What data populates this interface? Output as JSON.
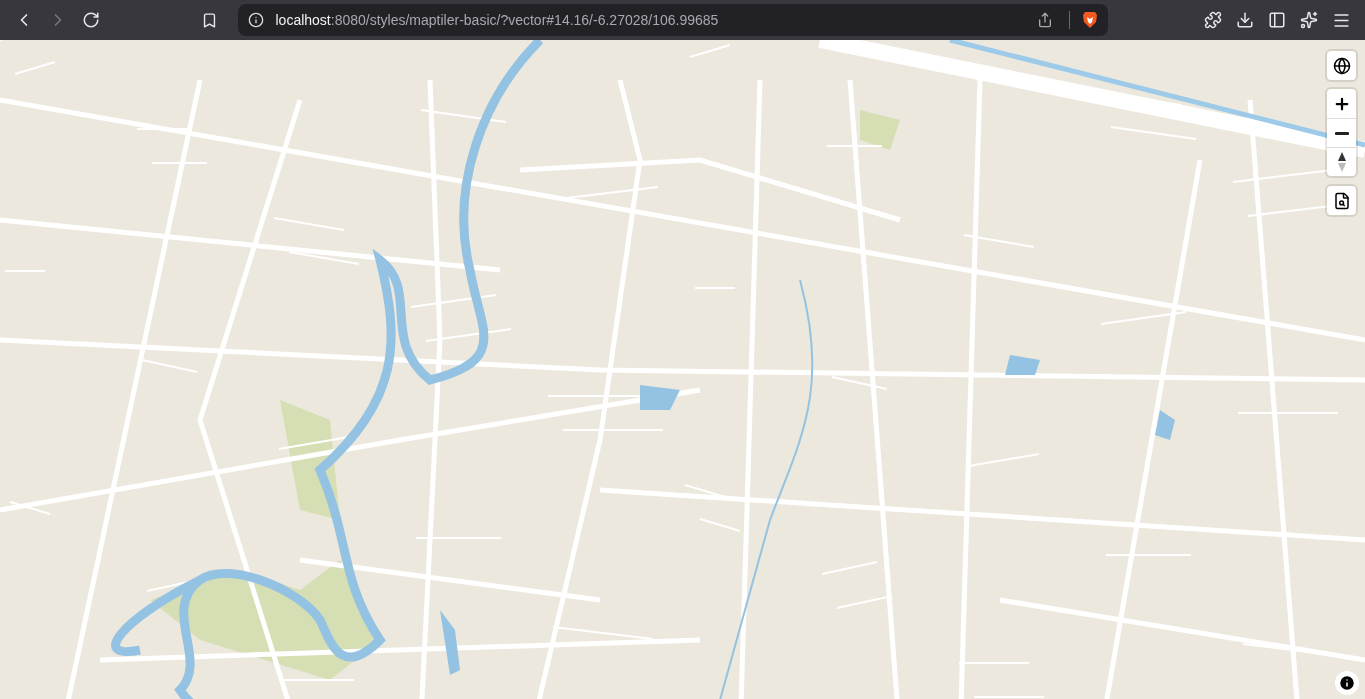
{
  "browser": {
    "back_enabled": true,
    "forward_enabled": false,
    "url_host": "localhost",
    "url_path": ":8080/styles/maptiler-basic/?vector#14.16/-6.27028/106.99685"
  }
}
